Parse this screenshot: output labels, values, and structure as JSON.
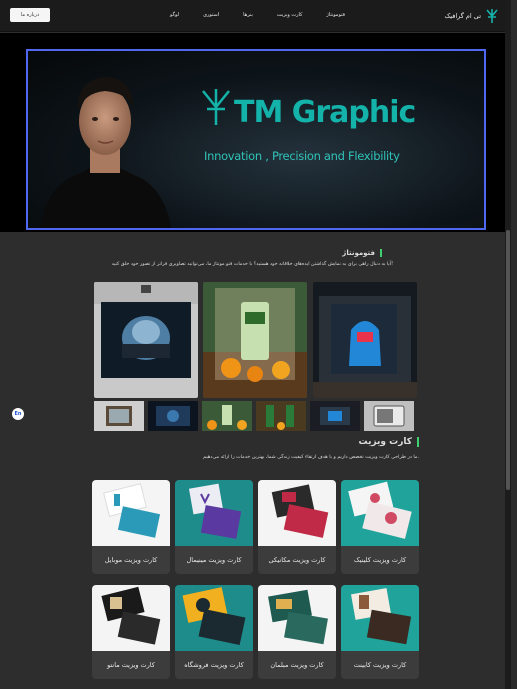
{
  "header": {
    "brand": "تی ام گرافیک",
    "about_button": "درباره ما",
    "nav": [
      "فتومونتاژ",
      "کارت ویزیت",
      "بنرها",
      "استوری",
      "لوگو"
    ]
  },
  "hero": {
    "title": "TM Graphic",
    "subtitle": "Innovation , Precision and Flexibility"
  },
  "photomontage": {
    "title": "فتومونتاژ",
    "description": "آیا به دنبال راهی برای به نمایش گذاشتن ایده‌های خلاقانه خود هستید؟ با خدمات فتو مونتاژ ما، می‌توانید تصاویری فراتر از تصور خود خلق کنید!"
  },
  "business_cards": {
    "title": "کارت ویزیت",
    "description": "ما در طراحی کارت ویزیت تخصص داریم و با هدف ارتقاء کیفیت زندگی شما، بهترین خدمات را ارائه می‌دهیم.",
    "cards": [
      {
        "label": "کارت ویزیت کلینیک"
      },
      {
        "label": "کارت ویزیت مکانیکی"
      },
      {
        "label": "کارت ویزیت مینیمال"
      },
      {
        "label": "کارت ویزیت موبایل"
      },
      {
        "label": "کارت ویزیت کابینت"
      },
      {
        "label": "کارت ویزیت مبلمان"
      },
      {
        "label": "کارت ویزیت فروشگاه"
      },
      {
        "label": "کارت ویزیت مانتو"
      }
    ]
  },
  "side_button": "En",
  "colors": {
    "accent_green": "#3ecf71",
    "brand_teal": "#14b3aa",
    "hero_border": "#5068f0"
  }
}
